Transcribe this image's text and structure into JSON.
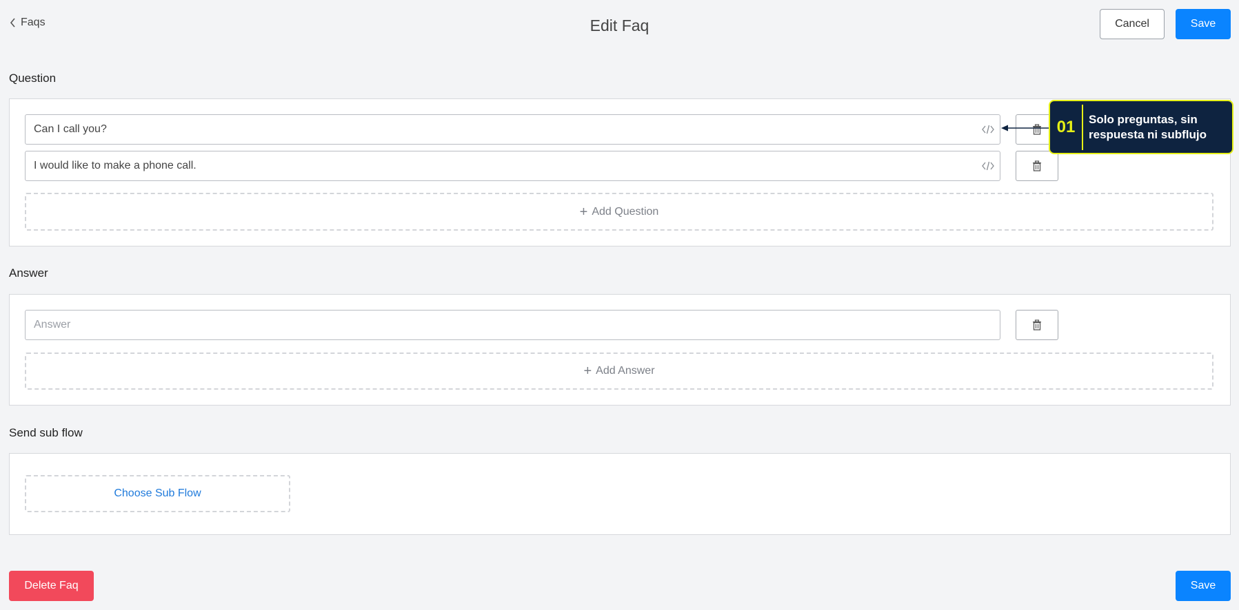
{
  "header": {
    "back_label": "Faqs",
    "title": "Edit Faq",
    "cancel_label": "Cancel",
    "save_label": "Save"
  },
  "question_section": {
    "title": "Question",
    "items": [
      {
        "value": "Can I call you?"
      },
      {
        "value": "I would like to make a phone call."
      }
    ],
    "add_label": "Add Question"
  },
  "answer_section": {
    "title": "Answer",
    "placeholder": "Answer",
    "add_label": "Add Answer"
  },
  "subflow_section": {
    "title": "Send sub flow",
    "choose_label": "Choose Sub Flow"
  },
  "footer": {
    "delete_label": "Delete Faq",
    "save_label": "Save"
  },
  "callout": {
    "number": "01",
    "text_line1": "Solo preguntas, sin",
    "text_line2": "respuesta ni subflujo"
  },
  "colors": {
    "primary": "#0a84ff",
    "danger": "#f2495b",
    "callout_bg": "#0e2340",
    "callout_accent": "#e6f016",
    "link": "#1f7adb"
  }
}
